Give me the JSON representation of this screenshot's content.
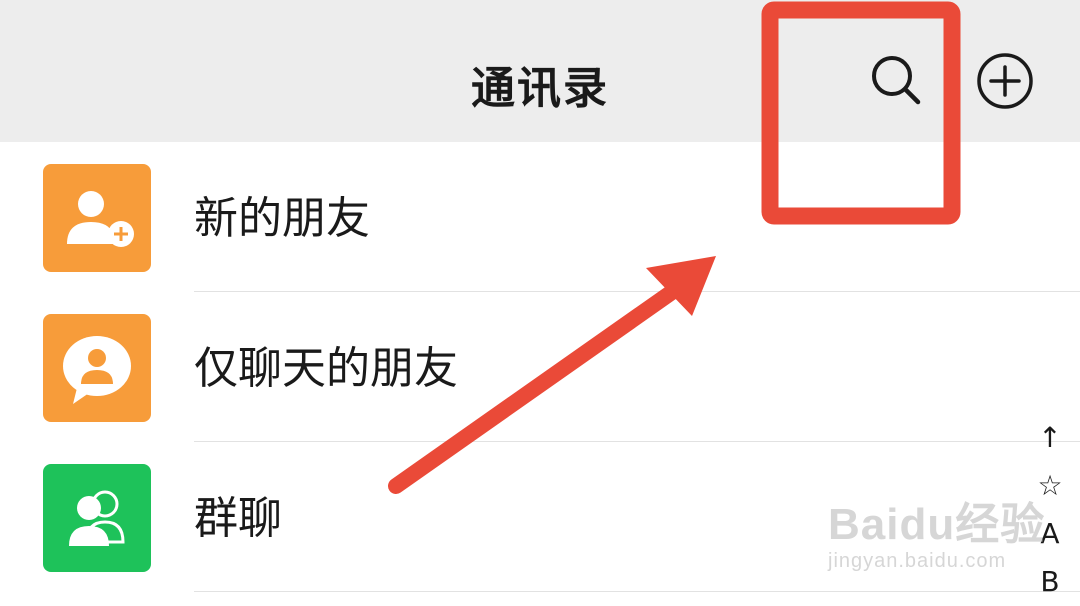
{
  "header": {
    "title": "通讯录",
    "search_icon": "search-icon",
    "add_icon": "plus-circle-icon"
  },
  "contacts_menu": [
    {
      "label": "新的朋友",
      "icon": "add-friend-icon",
      "color": "#f79c3a"
    },
    {
      "label": "仅聊天的朋友",
      "icon": "chat-only-friend-icon",
      "color": "#f79c3a"
    },
    {
      "label": "群聊",
      "icon": "group-chat-icon",
      "color": "#1ec25a"
    }
  ],
  "index_bar": [
    "↑",
    "☆",
    "A",
    "B"
  ],
  "annotation": {
    "color": "#ea4a38",
    "highlight_target": "search-icon"
  },
  "watermark": {
    "brand": "Baidu经验",
    "url": "jingyan.baidu.com"
  }
}
